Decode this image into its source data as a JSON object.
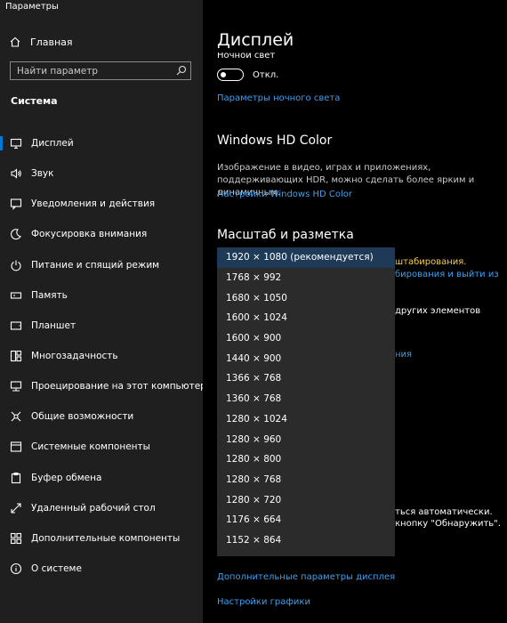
{
  "app": {
    "title": "Параметры"
  },
  "sidebar": {
    "home_label": "Главная",
    "search_placeholder": "Найти параметр",
    "section": "Система",
    "items": [
      {
        "label": "Дисплей",
        "icon": "monitor-icon",
        "active": true
      },
      {
        "label": "Звук",
        "icon": "speaker-icon"
      },
      {
        "label": "Уведомления и действия",
        "icon": "notification-icon"
      },
      {
        "label": "Фокусировка внимания",
        "icon": "moon-icon"
      },
      {
        "label": "Питание и спящий режим",
        "icon": "power-icon"
      },
      {
        "label": "Память",
        "icon": "storage-icon"
      },
      {
        "label": "Планшет",
        "icon": "tablet-icon"
      },
      {
        "label": "Многозадачность",
        "icon": "multitasking-icon"
      },
      {
        "label": "Проецирование на этот компьютер",
        "icon": "projecting-icon"
      },
      {
        "label": "Общие возможности",
        "icon": "shared-icon"
      },
      {
        "label": "Системные компоненты",
        "icon": "components-icon"
      },
      {
        "label": "Буфер обмена",
        "icon": "clipboard-icon"
      },
      {
        "label": "Удаленный рабочий стол",
        "icon": "remote-desktop-icon"
      },
      {
        "label": "Дополнительные компоненты",
        "icon": "optional-features-icon"
      },
      {
        "label": "О системе",
        "icon": "info-icon"
      }
    ]
  },
  "main": {
    "title": "Дисплей",
    "night_light_label": "Ночной свет",
    "toggle_state": "Откл.",
    "night_light_settings_link": "Параметры ночного света",
    "hd_color": {
      "title": "Windows HD Color",
      "description": "Изображение в видео, играх и приложениях, поддерживающих HDR, можно сделать более ярким и динамичным.",
      "link": "Настройки Windows HD Color"
    },
    "scale_title": "Масштаб и разметка",
    "fragments": {
      "f1": "штабирования.",
      "f2": "бирования и выйти из",
      "f3": "других элементов",
      "f4": "ния",
      "f5": "ться автоматически.",
      "f6": "кнопку \"Обнаружить\"."
    },
    "advanced_link": "Дополнительные параметры дисплея",
    "graphics_link": "Настройки графики"
  },
  "resolution_dropdown": {
    "options": [
      "1920 × 1080 (рекомендуется)",
      "1768 × 992",
      "1680 × 1050",
      "1600 × 1024",
      "1600 × 900",
      "1440 × 900",
      "1366 × 768",
      "1360 × 768",
      "1280 × 1024",
      "1280 × 960",
      "1280 × 800",
      "1280 × 768",
      "1280 × 720",
      "1176 × 664",
      "1152 × 864"
    ],
    "selected_index": 0
  },
  "colors": {
    "accent": "#0078d7",
    "link": "#3fa0ef",
    "warning": "#f7d046",
    "sidebar_bg": "#1f1f1f"
  }
}
